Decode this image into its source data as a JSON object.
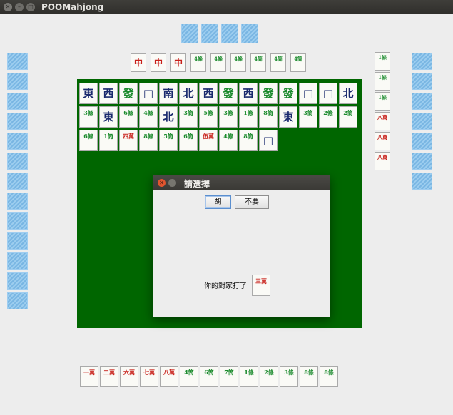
{
  "window": {
    "title": "POOMahjong"
  },
  "colors": {
    "felt": "#006600",
    "tile_back": "#87bfe8",
    "red": "#c8201a",
    "green": "#1a8a2c",
    "blue": "#1a2a6e"
  },
  "opponent_top": {
    "hand_count": 4
  },
  "top_melds": [
    {
      "kind": "dragon",
      "text": "中",
      "color": "red"
    },
    {
      "kind": "dragon",
      "text": "中",
      "color": "red"
    },
    {
      "kind": "dragon",
      "text": "中",
      "color": "red"
    },
    {
      "kind": "bamboo",
      "text": "4條",
      "color": "green"
    },
    {
      "kind": "bamboo",
      "text": "4條",
      "color": "green"
    },
    {
      "kind": "bamboo",
      "text": "4條",
      "color": "green"
    },
    {
      "kind": "circle",
      "text": "4筒",
      "color": "green"
    },
    {
      "kind": "circle",
      "text": "4筒",
      "color": "green"
    },
    {
      "kind": "circle",
      "text": "4筒",
      "color": "green"
    }
  ],
  "opponent_left": {
    "hand_count": 13
  },
  "opponent_right": {
    "hand_count": 7
  },
  "right_melds": [
    {
      "kind": "bamboo",
      "text": "1條",
      "color": "green"
    },
    {
      "kind": "bamboo",
      "text": "1條",
      "color": "green"
    },
    {
      "kind": "bamboo",
      "text": "1條",
      "color": "green"
    },
    {
      "kind": "char",
      "text": "八萬",
      "color": "red"
    },
    {
      "kind": "char",
      "text": "八萬",
      "color": "red"
    },
    {
      "kind": "char",
      "text": "八萬",
      "color": "red"
    }
  ],
  "discards": [
    [
      {
        "text": "東",
        "color": "blue"
      },
      {
        "text": "西",
        "color": "blue"
      },
      {
        "text": "發",
        "color": "green"
      },
      {
        "text": "□",
        "color": "blue"
      },
      {
        "text": "南",
        "color": "blue"
      },
      {
        "text": "北",
        "color": "blue"
      },
      {
        "text": "西",
        "color": "blue"
      },
      {
        "text": "發",
        "color": "green"
      },
      {
        "text": "西",
        "color": "blue"
      },
      {
        "text": "發",
        "color": "green"
      },
      {
        "text": "發",
        "color": "green"
      },
      {
        "text": "□",
        "color": "blue"
      },
      {
        "text": "□",
        "color": "blue"
      },
      {
        "text": "北",
        "color": "blue"
      }
    ],
    [
      {
        "text": "3條",
        "color": "green"
      },
      {
        "text": "東",
        "color": "blue"
      },
      {
        "text": "6條",
        "color": "green"
      },
      {
        "text": "4條",
        "color": "green"
      },
      {
        "text": "北",
        "color": "blue"
      },
      {
        "text": "3筒",
        "color": "green"
      },
      {
        "text": "5條",
        "color": "green"
      },
      {
        "text": "3條",
        "color": "green"
      },
      {
        "text": "1條",
        "color": "green"
      },
      {
        "text": "8筒",
        "color": "green"
      },
      {
        "text": "東",
        "color": "blue"
      },
      {
        "text": "3筒",
        "color": "green"
      },
      {
        "text": "2條",
        "color": "green"
      },
      {
        "text": "2筒",
        "color": "green"
      }
    ],
    [
      {
        "text": "6條",
        "color": "green"
      },
      {
        "text": "1筒",
        "color": "green"
      },
      {
        "text": "四萬",
        "color": "red"
      },
      {
        "text": "8條",
        "color": "green"
      },
      {
        "text": "5筒",
        "color": "green"
      },
      {
        "text": "6筒",
        "color": "green"
      },
      {
        "text": "伍萬",
        "color": "red"
      },
      {
        "text": "4條",
        "color": "green"
      },
      {
        "text": "8筒",
        "color": "green"
      },
      {
        "text": "□",
        "color": "blue"
      }
    ]
  ],
  "dialog": {
    "title": "請選擇",
    "win_button": "胡",
    "pass_button": "不要",
    "message": "你的對家打了",
    "tile": {
      "text": "三萬",
      "color": "red"
    }
  },
  "player_hand": [
    {
      "text": "一萬",
      "color": "red"
    },
    {
      "text": "二萬",
      "color": "red"
    },
    {
      "text": "六萬",
      "color": "red"
    },
    {
      "text": "七萬",
      "color": "red"
    },
    {
      "text": "八萬",
      "color": "red"
    },
    {
      "text": "4筒",
      "color": "green"
    },
    {
      "text": "6筒",
      "color": "green"
    },
    {
      "text": "7筒",
      "color": "green"
    },
    {
      "text": "1條",
      "color": "green"
    },
    {
      "text": "2條",
      "color": "green"
    },
    {
      "text": "3條",
      "color": "green"
    },
    {
      "text": "8條",
      "color": "green"
    },
    {
      "text": "8條",
      "color": "green"
    }
  ]
}
